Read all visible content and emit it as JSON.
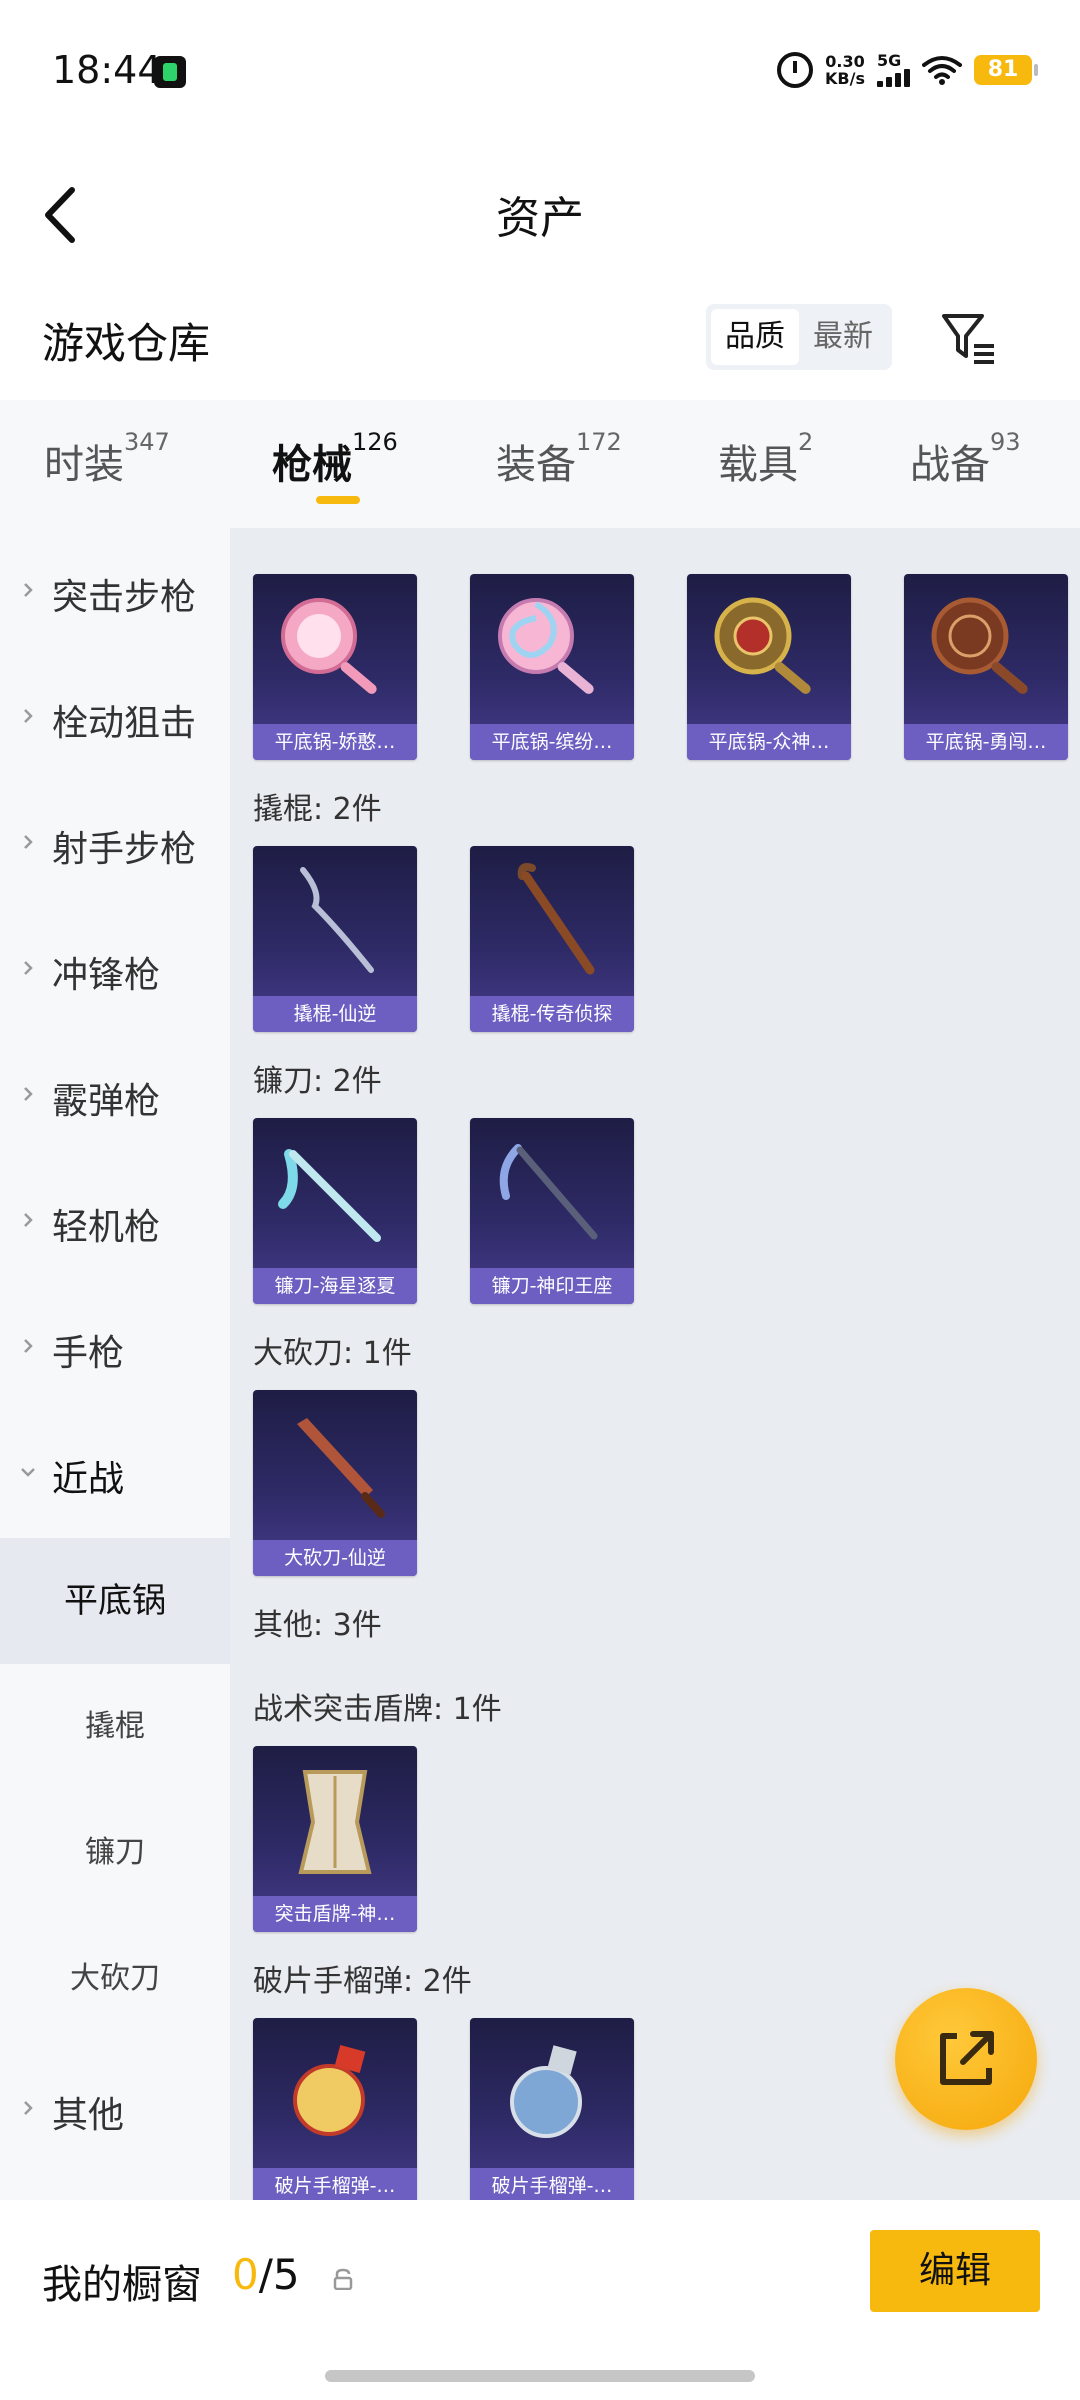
{
  "status_bar": {
    "time": "18:44",
    "net_speed_value": "0.30",
    "net_speed_unit": "KB/s",
    "network": "5G",
    "battery": "81"
  },
  "header": {
    "title": "资产"
  },
  "warehouse": {
    "title": "游戏仓库",
    "sort_options": [
      "品质",
      "最新"
    ],
    "active_sort": "品质"
  },
  "tabs": [
    {
      "label": "时装",
      "count": "347"
    },
    {
      "label": "枪械",
      "count": "126",
      "active": true
    },
    {
      "label": "装备",
      "count": "172"
    },
    {
      "label": "载具",
      "count": "2"
    },
    {
      "label": "战备",
      "count": "93"
    }
  ],
  "sidebar": {
    "categories": [
      "突击步枪",
      "栓动狙击",
      "射手步枪",
      "冲锋枪",
      "霰弹枪",
      "轻机枪",
      "手枪",
      "近战"
    ],
    "subcategories": [
      "平底锅",
      "撬棍",
      "镰刀",
      "大砍刀"
    ],
    "active_subcategory": "平底锅",
    "last_category": "其他"
  },
  "content": {
    "pan_items": [
      "平底锅-娇憨…",
      "平底锅-缤纷…",
      "平底锅-众神…",
      "平底锅-勇闯…"
    ],
    "groups": [
      {
        "heading": "撬棍: 2件",
        "items": [
          "撬棍-仙逆",
          "撬棍-传奇侦探"
        ]
      },
      {
        "heading": "镰刀: 2件",
        "items": [
          "镰刀-海星逐夏",
          "镰刀-神印王座"
        ]
      },
      {
        "heading": "大砍刀: 1件",
        "items": [
          "大砍刀-仙逆"
        ]
      },
      {
        "heading": "其他: 3件",
        "items": []
      },
      {
        "heading": "战术突击盾牌: 1件",
        "items": [
          "突击盾牌-神…"
        ]
      },
      {
        "heading": "破片手榴弹: 2件",
        "items": [
          "破片手榴弹-…",
          "破片手榴弹-…"
        ]
      }
    ]
  },
  "bottom_bar": {
    "label": "我的橱窗",
    "current": "0",
    "total": "/5",
    "edit_label": "编辑"
  },
  "colors": {
    "accent": "#f7b90e",
    "card_caption": "#6d5fc2",
    "card_bg": "#2e2a66"
  }
}
